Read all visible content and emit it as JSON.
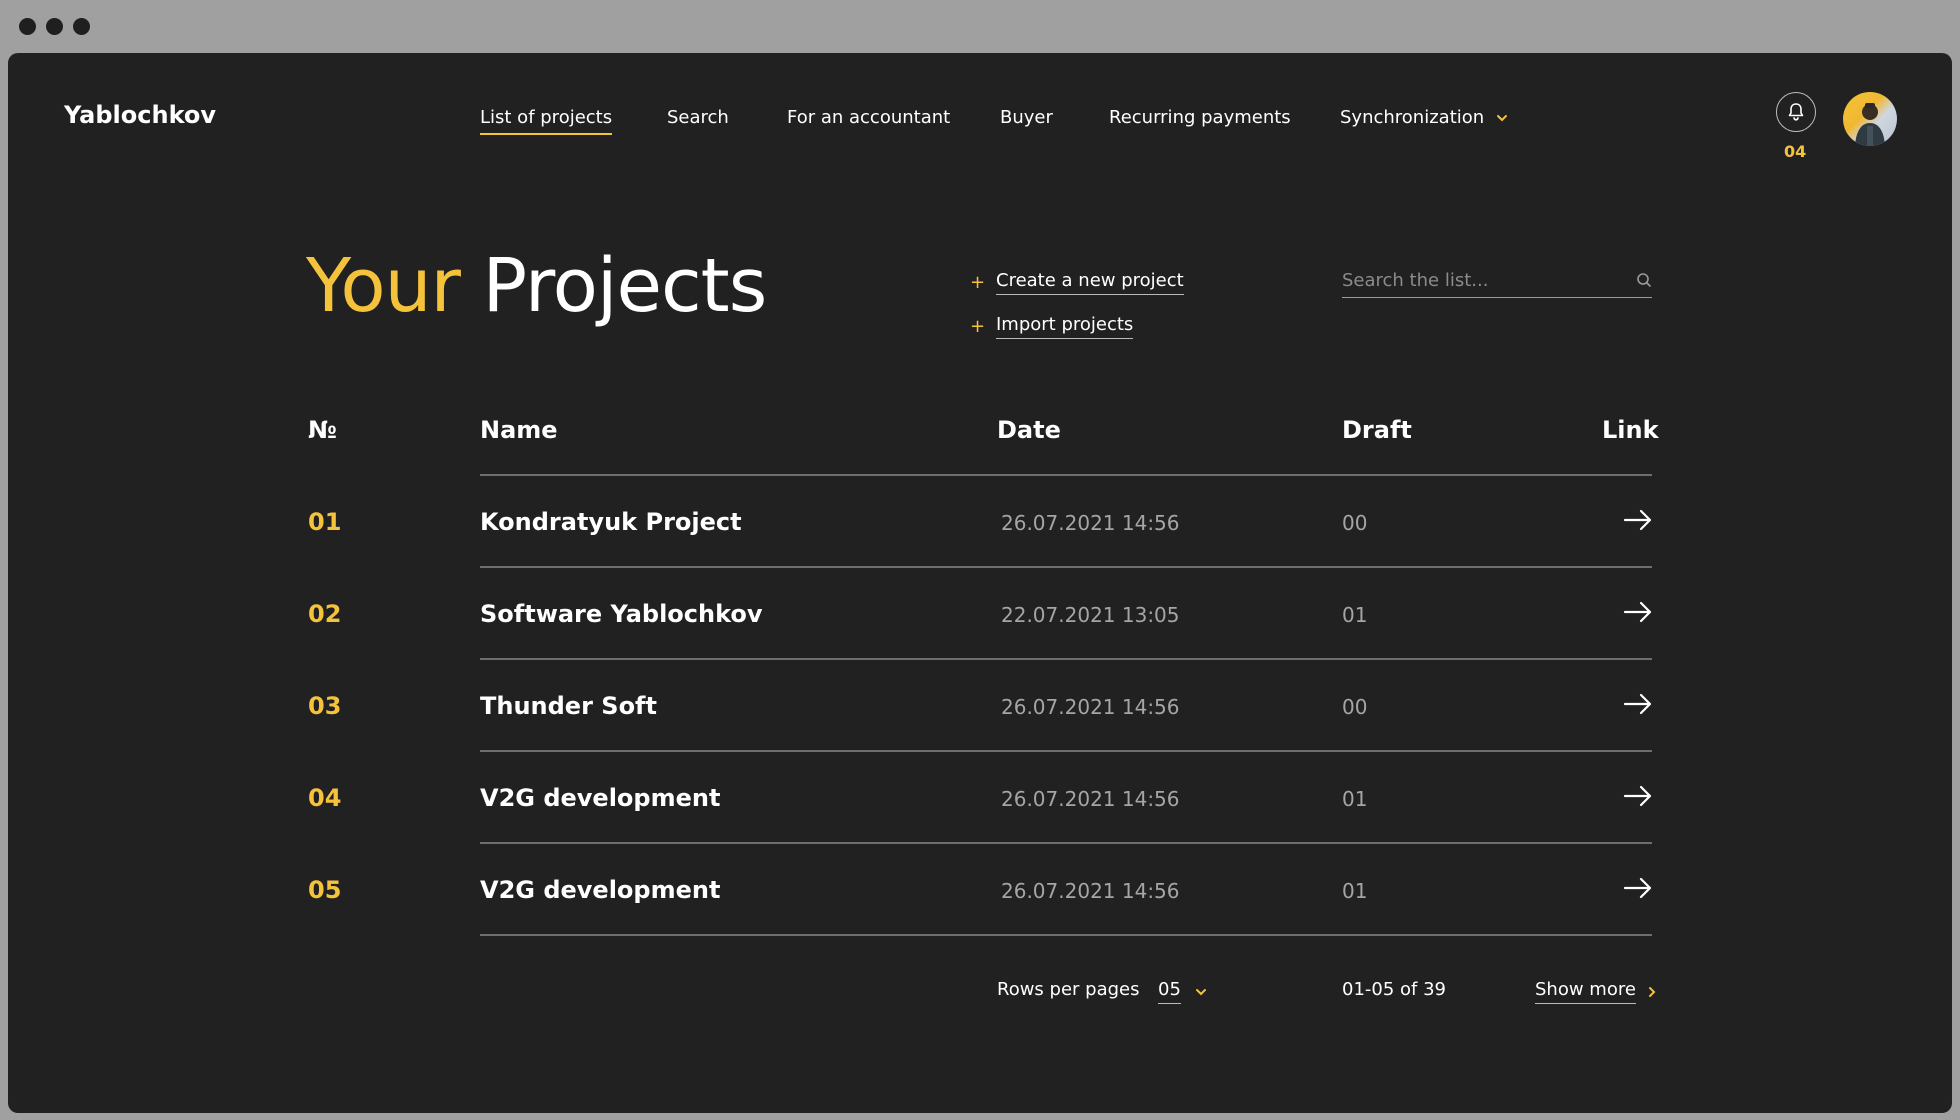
{
  "brand": "Yablochkov",
  "nav": {
    "items": [
      "List of projects",
      "Search",
      "For an accountant",
      "Buyer",
      "Recurring payments",
      "Synchronization"
    ],
    "active": "List of projects"
  },
  "notifications": {
    "count": "04",
    "icon": "bell-icon"
  },
  "avatar": {
    "icon": "user-avatar"
  },
  "page": {
    "title_highlight": "Your",
    "title_rest": "Projects"
  },
  "actions": {
    "create": "Create a new project",
    "import": "Import projects"
  },
  "search": {
    "placeholder": "Search the list..."
  },
  "table": {
    "headers": {
      "num": "№",
      "name": "Name",
      "date": "Date",
      "draft": "Draft",
      "link": "Link"
    },
    "rows": [
      {
        "num": "01",
        "name": "Kondratyuk Project",
        "date": "26.07.2021 14:56",
        "draft": "00"
      },
      {
        "num": "02",
        "name": "Software Yablochkov",
        "date": "22.07.2021 13:05",
        "draft": "01"
      },
      {
        "num": "03",
        "name": "Thunder Soft",
        "date": "26.07.2021 14:56",
        "draft": "00"
      },
      {
        "num": "04",
        "name": "V2G development",
        "date": "26.07.2021 14:56",
        "draft": "01"
      },
      {
        "num": "05",
        "name": "V2G development",
        "date": "26.07.2021 14:56",
        "draft": "01"
      }
    ]
  },
  "pagination": {
    "rows_label": "Rows per pages",
    "rows_value": "05",
    "range": "01-05 of 39",
    "show_more": "Show more"
  },
  "colors": {
    "accent": "#f5c33b",
    "background": "#212121",
    "text": "#ffffff",
    "muted": "#a5a5a5"
  }
}
